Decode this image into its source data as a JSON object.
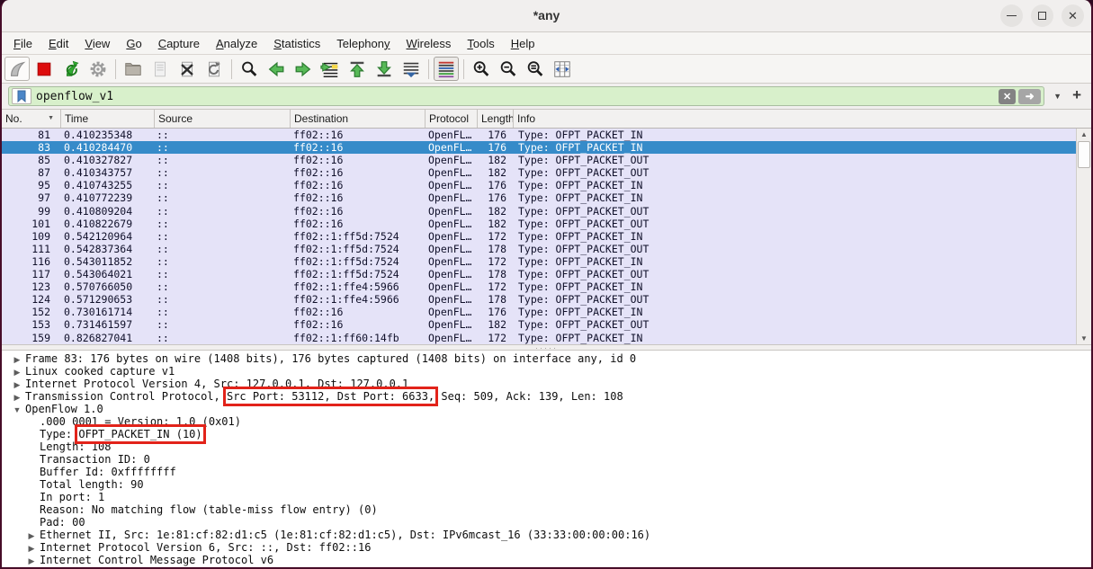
{
  "window": {
    "title": "*any"
  },
  "titlebar": {
    "controls": [
      "minimize",
      "maximize",
      "close"
    ]
  },
  "menu": {
    "items": [
      {
        "label": "File",
        "u": 0
      },
      {
        "label": "Edit",
        "u": 0
      },
      {
        "label": "View",
        "u": 0
      },
      {
        "label": "Go",
        "u": 0
      },
      {
        "label": "Capture",
        "u": 0
      },
      {
        "label": "Analyze",
        "u": 0
      },
      {
        "label": "Statistics",
        "u": 0
      },
      {
        "label": "Telephony",
        "u": 8
      },
      {
        "label": "Wireless",
        "u": 0
      },
      {
        "label": "Tools",
        "u": 0
      },
      {
        "label": "Help",
        "u": 0
      }
    ]
  },
  "toolbar": {
    "buttons": [
      {
        "name": "start-capture",
        "style": "framed",
        "group_end": false
      },
      {
        "name": "stop-capture",
        "style": "",
        "group_end": false
      },
      {
        "name": "restart-capture",
        "style": "",
        "group_end": false
      },
      {
        "name": "capture-options",
        "style": "",
        "group_end": true
      },
      {
        "name": "open-file",
        "style": "",
        "group_end": false
      },
      {
        "name": "save-file",
        "style": "",
        "group_end": false
      },
      {
        "name": "close-file",
        "style": "",
        "group_end": false
      },
      {
        "name": "reload-file",
        "style": "",
        "group_end": true
      },
      {
        "name": "find-packet",
        "style": "",
        "group_end": false
      },
      {
        "name": "go-back",
        "style": "",
        "group_end": false
      },
      {
        "name": "go-forward",
        "style": "",
        "group_end": false
      },
      {
        "name": "go-to-packet",
        "style": "",
        "group_end": false
      },
      {
        "name": "go-first",
        "style": "",
        "group_end": false
      },
      {
        "name": "go-last",
        "style": "",
        "group_end": false
      },
      {
        "name": "auto-scroll",
        "style": "",
        "group_end": true
      },
      {
        "name": "colorize",
        "style": "pressed",
        "group_end": true
      },
      {
        "name": "zoom-in",
        "style": "",
        "group_end": false
      },
      {
        "name": "zoom-out",
        "style": "",
        "group_end": false
      },
      {
        "name": "zoom-original",
        "style": "",
        "group_end": false
      },
      {
        "name": "resize-columns",
        "style": "",
        "group_end": false
      }
    ]
  },
  "filter": {
    "value": "openflow_v1",
    "clear_label": "✕",
    "apply_label": "➜",
    "chevron": "▼",
    "add_label": "+"
  },
  "packet_list": {
    "columns": [
      {
        "label": "No.",
        "cls": "c-no",
        "sort": "▼"
      },
      {
        "label": "Time",
        "cls": "c-time",
        "sort": ""
      },
      {
        "label": "Source",
        "cls": "c-src",
        "sort": ""
      },
      {
        "label": "Destination",
        "cls": "c-dst",
        "sort": ""
      },
      {
        "label": "Protocol",
        "cls": "c-proto",
        "sort": ""
      },
      {
        "label": "Length",
        "cls": "c-len",
        "sort": ""
      },
      {
        "label": "Info",
        "cls": "c-info",
        "sort": ""
      }
    ],
    "rows": [
      {
        "no": "81",
        "time": "0.410235348",
        "source": "::",
        "destination": "ff02::16",
        "protocol": "OpenFL…",
        "length": "176",
        "info": "Type: OFPT_PACKET_IN",
        "selected": false
      },
      {
        "no": "83",
        "time": "0.410284470",
        "source": "::",
        "destination": "ff02::16",
        "protocol": "OpenFL…",
        "length": "176",
        "info": "Type: OFPT_PACKET_IN",
        "selected": true
      },
      {
        "no": "85",
        "time": "0.410327827",
        "source": "::",
        "destination": "ff02::16",
        "protocol": "OpenFL…",
        "length": "182",
        "info": "Type: OFPT_PACKET_OUT",
        "selected": false
      },
      {
        "no": "87",
        "time": "0.410343757",
        "source": "::",
        "destination": "ff02::16",
        "protocol": "OpenFL…",
        "length": "182",
        "info": "Type: OFPT_PACKET_OUT",
        "selected": false
      },
      {
        "no": "95",
        "time": "0.410743255",
        "source": "::",
        "destination": "ff02::16",
        "protocol": "OpenFL…",
        "length": "176",
        "info": "Type: OFPT_PACKET_IN",
        "selected": false
      },
      {
        "no": "97",
        "time": "0.410772239",
        "source": "::",
        "destination": "ff02::16",
        "protocol": "OpenFL…",
        "length": "176",
        "info": "Type: OFPT_PACKET_IN",
        "selected": false
      },
      {
        "no": "99",
        "time": "0.410809204",
        "source": "::",
        "destination": "ff02::16",
        "protocol": "OpenFL…",
        "length": "182",
        "info": "Type: OFPT_PACKET_OUT",
        "selected": false
      },
      {
        "no": "101",
        "time": "0.410822679",
        "source": "::",
        "destination": "ff02::16",
        "protocol": "OpenFL…",
        "length": "182",
        "info": "Type: OFPT_PACKET_OUT",
        "selected": false
      },
      {
        "no": "109",
        "time": "0.542120964",
        "source": "::",
        "destination": "ff02::1:ff5d:7524",
        "protocol": "OpenFL…",
        "length": "172",
        "info": "Type: OFPT_PACKET_IN",
        "selected": false
      },
      {
        "no": "111",
        "time": "0.542837364",
        "source": "::",
        "destination": "ff02::1:ff5d:7524",
        "protocol": "OpenFL…",
        "length": "178",
        "info": "Type: OFPT_PACKET_OUT",
        "selected": false
      },
      {
        "no": "116",
        "time": "0.543011852",
        "source": "::",
        "destination": "ff02::1:ff5d:7524",
        "protocol": "OpenFL…",
        "length": "172",
        "info": "Type: OFPT_PACKET_IN",
        "selected": false
      },
      {
        "no": "117",
        "time": "0.543064021",
        "source": "::",
        "destination": "ff02::1:ff5d:7524",
        "protocol": "OpenFL…",
        "length": "178",
        "info": "Type: OFPT_PACKET_OUT",
        "selected": false
      },
      {
        "no": "123",
        "time": "0.570766050",
        "source": "::",
        "destination": "ff02::1:ffe4:5966",
        "protocol": "OpenFL…",
        "length": "172",
        "info": "Type: OFPT_PACKET_IN",
        "selected": false
      },
      {
        "no": "124",
        "time": "0.571290653",
        "source": "::",
        "destination": "ff02::1:ffe4:5966",
        "protocol": "OpenFL…",
        "length": "178",
        "info": "Type: OFPT_PACKET_OUT",
        "selected": false
      },
      {
        "no": "152",
        "time": "0.730161714",
        "source": "::",
        "destination": "ff02::16",
        "protocol": "OpenFL…",
        "length": "176",
        "info": "Type: OFPT_PACKET_IN",
        "selected": false
      },
      {
        "no": "153",
        "time": "0.731461597",
        "source": "::",
        "destination": "ff02::16",
        "protocol": "OpenFL…",
        "length": "182",
        "info": "Type: OFPT_PACKET_OUT",
        "selected": false
      },
      {
        "no": "159",
        "time": "0.826827041",
        "source": "::",
        "destination": "ff02::1:ff60:14fb",
        "protocol": "OpenFL…",
        "length": "172",
        "info": "Type: OFPT_PACKET_IN",
        "selected": false
      }
    ]
  },
  "details": {
    "lines": [
      {
        "level": 0,
        "arrow": "collapsed",
        "parts": [
          {
            "text": "Frame 83: 176 bytes on wire (1408 bits), 176 bytes captured (1408 bits) on interface any, id 0",
            "box": false
          }
        ]
      },
      {
        "level": 0,
        "arrow": "collapsed",
        "parts": [
          {
            "text": "Linux cooked capture v1",
            "box": false
          }
        ]
      },
      {
        "level": 0,
        "arrow": "collapsed",
        "parts": [
          {
            "text": "Internet Protocol Version 4, Src: 127.0.0.1, Dst: 127.0.0.1",
            "box": false
          }
        ]
      },
      {
        "level": 0,
        "arrow": "collapsed",
        "parts": [
          {
            "text": "Transmission Control Protocol, ",
            "box": false
          },
          {
            "text": "Src Port: 53112, Dst Port: 6633,",
            "box": true
          },
          {
            "text": " Seq: 509, Ack: 139, Len: 108",
            "box": false
          }
        ]
      },
      {
        "level": 0,
        "arrow": "expanded",
        "parts": [
          {
            "text": "OpenFlow 1.0",
            "box": false
          }
        ]
      },
      {
        "level": 1,
        "arrow": "none",
        "parts": [
          {
            "text": ".000 0001 = Version: 1.0 (0x01)",
            "box": false
          }
        ]
      },
      {
        "level": 1,
        "arrow": "none",
        "parts": [
          {
            "text": "Type: ",
            "box": false
          },
          {
            "text": "OFPT_PACKET_IN (10)",
            "box": true
          }
        ]
      },
      {
        "level": 1,
        "arrow": "none",
        "parts": [
          {
            "text": "Length: 108",
            "box": false
          }
        ]
      },
      {
        "level": 1,
        "arrow": "none",
        "parts": [
          {
            "text": "Transaction ID: 0",
            "box": false
          }
        ]
      },
      {
        "level": 1,
        "arrow": "none",
        "parts": [
          {
            "text": "Buffer Id: 0xffffffff",
            "box": false
          }
        ]
      },
      {
        "level": 1,
        "arrow": "none",
        "parts": [
          {
            "text": "Total length: 90",
            "box": false
          }
        ]
      },
      {
        "level": 1,
        "arrow": "none",
        "parts": [
          {
            "text": "In port: 1",
            "box": false
          }
        ]
      },
      {
        "level": 1,
        "arrow": "none",
        "parts": [
          {
            "text": "Reason: No matching flow (table-miss flow entry) (0)",
            "box": false
          }
        ]
      },
      {
        "level": 1,
        "arrow": "none",
        "parts": [
          {
            "text": "Pad: 00",
            "box": false
          }
        ]
      },
      {
        "level": 1,
        "arrow": "collapsed",
        "parts": [
          {
            "text": "Ethernet II, Src: 1e:81:cf:82:d1:c5 (1e:81:cf:82:d1:c5), Dst: IPv6mcast_16 (33:33:00:00:00:16)",
            "box": false
          }
        ]
      },
      {
        "level": 1,
        "arrow": "collapsed",
        "parts": [
          {
            "text": "Internet Protocol Version 6, Src: ::, Dst: ff02::16",
            "box": false
          }
        ]
      },
      {
        "level": 1,
        "arrow": "collapsed",
        "parts": [
          {
            "text": "Internet Control Message Protocol v6",
            "box": false
          }
        ]
      }
    ]
  },
  "colors": {
    "selected_row": "#368bc9",
    "row_background": "#e5e3f8",
    "filter_background": "#d8f0cb",
    "annotation_box": "#e2231a",
    "titlebar": "#f1efee"
  }
}
